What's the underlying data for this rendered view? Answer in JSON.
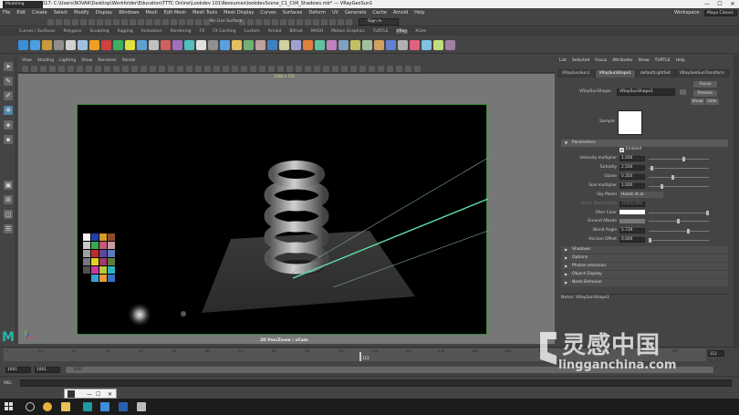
{
  "titlebar": {
    "title": "Autodesk Maya 2017: C:\\Users\\NOVAK\\Desktop\\Workfolder\\Education\\TTTC Online\\Lookdev 101\\Resources\\lookdevScene_C1_C04_Shadows.mb*   ---   VRayGeoSun1",
    "min": "—",
    "max": "☐",
    "close": "✕"
  },
  "menubar": {
    "items": [
      "File",
      "Edit",
      "Create",
      "Select",
      "Modify",
      "Display",
      "Windows",
      "Mesh",
      "Edit Mesh",
      "Mesh Tools",
      "Mesh Display",
      "Curves",
      "Surfaces",
      "Deform",
      "UV",
      "Generate",
      "Cache",
      "Arnold",
      "Help"
    ],
    "workspace_label": "Workspace:",
    "workspace_value": "Maya Classic"
  },
  "statusline": {
    "mode": "Modeling",
    "no_live": "No Live Surface",
    "sign_in": "Sign In"
  },
  "shelf": {
    "tabs": [
      "Curves / Surfaces",
      "Polygons",
      "Sculpting",
      "Rigging",
      "Animation",
      "Rendering",
      "FX",
      "FX Caching",
      "Custom",
      "Arnold",
      "Bifrost",
      "MASH",
      "Motion Graphics",
      "TURTLE",
      "VRay",
      "XGen"
    ],
    "active_tab": "VRay"
  },
  "viewport": {
    "menu": [
      "View",
      "Shading",
      "Lighting",
      "Show",
      "Renderer",
      "Panels"
    ],
    "resolution": "1280 x 720",
    "camera": "2D Pan/Zoom : vCam"
  },
  "toolbox": {
    "logo": "M"
  },
  "attribute_editor": {
    "menu": [
      "List",
      "Selected",
      "Focus",
      "Attributes",
      "Show",
      "TURTLE",
      "Help"
    ],
    "tabs": [
      "VRayGeoSun1",
      "VRaySunShape1",
      "defaultLightSet",
      "VRayGeoSunTransform"
    ],
    "active_tab": "VRaySunShape1",
    "node_label": "VRaySunShape:",
    "node_value": "VRaySunShape1",
    "buttons": {
      "focus": "Focus",
      "presets": "Presets",
      "show": "Show",
      "hide": "Hide"
    },
    "sample_label": "Sample",
    "sections": {
      "parameters": "Parameters",
      "shadows": "Shadows",
      "options": "Options",
      "photon_emission": "Photon emission",
      "object_display": "Object Display",
      "node_behavior": "Node Behavior"
    },
    "enabled_label": "Enabled",
    "enabled_check": "✔",
    "attrs": {
      "intensity_label": "Intensity multiplier",
      "intensity_value": "1.000",
      "turbidity_label": "Turbidity",
      "turbidity_value": "2.500",
      "ozone_label": "Ozone",
      "ozone_value": "0.350",
      "size_label": "Size multiplier",
      "size_value": "1.000",
      "sky_model_label": "Sky Model",
      "sky_model_value": "Hosek et al.",
      "horiz_illum_label": "Horiz. illumination",
      "horiz_illum_value": "25000.000",
      "filter_color_label": "Filter Color",
      "ground_albedo_label": "Ground Albedo",
      "blend_angle_label": "Blend Angle",
      "blend_angle_value": "5.739",
      "horizon_offset_label": "Horizon Offset",
      "horizon_offset_value": "0.000"
    },
    "notes_label": "Notes:  VRaySunShape1"
  },
  "timeline": {
    "ticks": [
      "1",
      "10",
      "20",
      "30",
      "40",
      "50",
      "60",
      "70",
      "80",
      "90",
      "100",
      "110",
      "120",
      "130",
      "140",
      "150",
      "160",
      "170",
      "180",
      "190",
      "200"
    ],
    "current_frame_marker": "112",
    "current_frame": "112"
  },
  "range": {
    "start": "1001",
    "start_inner": "1001",
    "range_start": "1001"
  },
  "command": {
    "label": "MEL"
  },
  "watermark": {
    "line1": "灵感中国",
    "line2": "lingganchina.com"
  }
}
